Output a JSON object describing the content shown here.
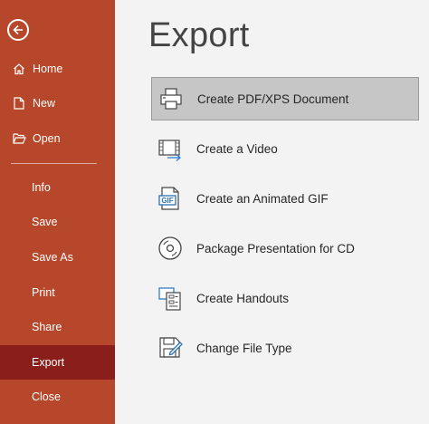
{
  "sidebar": {
    "back_icon": "back-arrow-icon",
    "items": [
      {
        "label": "Home",
        "icon": "home-icon"
      },
      {
        "label": "New",
        "icon": "new-document-icon"
      },
      {
        "label": "Open",
        "icon": "open-folder-icon"
      },
      {
        "label": "Info"
      },
      {
        "label": "Save"
      },
      {
        "label": "Save As"
      },
      {
        "label": "Print"
      },
      {
        "label": "Share"
      },
      {
        "label": "Export",
        "active": true
      },
      {
        "label": "Close"
      }
    ],
    "colors": {
      "background": "#b7472a",
      "active": "#8a1e1a"
    }
  },
  "main": {
    "title": "Export",
    "options": [
      {
        "label": "Create PDF/XPS Document",
        "icon": "pdf-xps-icon",
        "selected": true
      },
      {
        "label": "Create a Video",
        "icon": "video-icon"
      },
      {
        "label": "Create an Animated GIF",
        "icon": "gif-icon"
      },
      {
        "label": "Package Presentation for CD",
        "icon": "cd-icon"
      },
      {
        "label": "Create Handouts",
        "icon": "handouts-icon"
      },
      {
        "label": "Change File Type",
        "icon": "change-file-type-icon"
      }
    ]
  }
}
